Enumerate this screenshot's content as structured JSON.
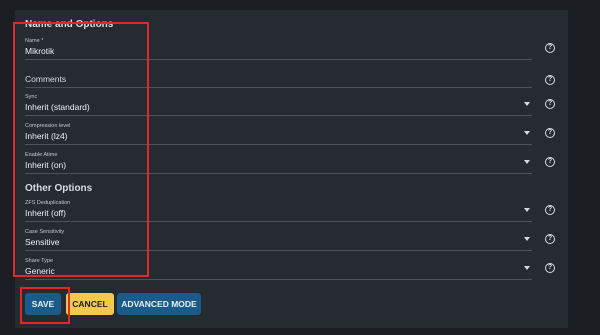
{
  "section_name_options": "Name and Options",
  "section_other_options": "Other Options",
  "fields": {
    "name": {
      "label": "Name *",
      "value": "Mikrotik"
    },
    "comments": {
      "label": "Comments"
    },
    "sync": {
      "label": "Sync",
      "value": "Inherit (standard)"
    },
    "compression": {
      "label": "Compression level",
      "value": "Inherit (lz4)"
    },
    "atime": {
      "label": "Enable Atime",
      "value": "Inherit (on)"
    },
    "dedup": {
      "label": "ZFS Deduplication",
      "value": "Inherit (off)"
    },
    "case_sensitivity": {
      "label": "Case Sensitivity",
      "value": "Sensitive"
    },
    "share_type": {
      "label": "Share Type",
      "value": "Generic"
    }
  },
  "help_glyph": "?",
  "buttons": {
    "save": "SAVE",
    "cancel": "CANCEL",
    "advanced": "ADVANCED MODE"
  },
  "colors": {
    "primary": "#1a5b8a",
    "cancel": "#f2c94c",
    "annotation": "#e02a2a"
  }
}
